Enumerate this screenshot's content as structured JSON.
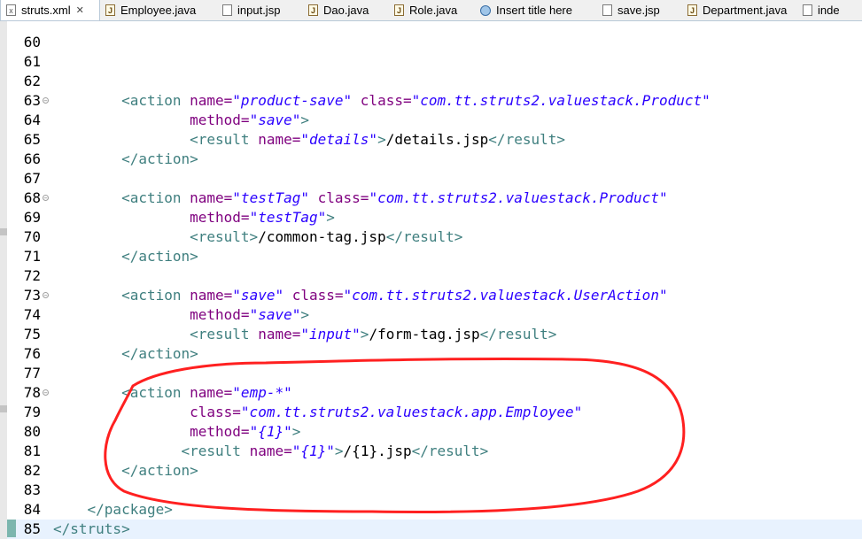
{
  "tabs": [
    {
      "label": "struts.xml",
      "icon": "xml-file-icon",
      "active": true
    },
    {
      "label": "Employee.java",
      "icon": "java-file-icon"
    },
    {
      "label": "input.jsp",
      "icon": "jsp-file-icon"
    },
    {
      "label": "Dao.java",
      "icon": "java-file-icon"
    },
    {
      "label": "Role.java",
      "icon": "java-file-icon"
    },
    {
      "label": "Insert title here",
      "icon": "web-browser-icon"
    },
    {
      "label": "save.jsp",
      "icon": "jsp-file-icon"
    },
    {
      "label": "Department.java",
      "icon": "java-file-icon"
    },
    {
      "label": "inde",
      "icon": "jsp-file-icon"
    }
  ],
  "close_glyph": "✕",
  "lines": [
    {
      "n": "60",
      "tokens": []
    },
    {
      "n": "61",
      "tokens": []
    },
    {
      "n": "62",
      "tokens": []
    },
    {
      "n": "63",
      "fold": true,
      "tokens": [
        {
          "t": "txt",
          "v": "        "
        },
        {
          "t": "tag",
          "v": "<action "
        },
        {
          "t": "attr",
          "v": "name="
        },
        {
          "t": "val",
          "v": "\"product-save\""
        },
        {
          "t": "txt",
          "v": " "
        },
        {
          "t": "attr",
          "v": "class="
        },
        {
          "t": "val",
          "v": "\"com.tt.struts2.valuestack.Product\""
        }
      ]
    },
    {
      "n": "64",
      "tokens": [
        {
          "t": "txt",
          "v": "                "
        },
        {
          "t": "attr",
          "v": "method="
        },
        {
          "t": "val",
          "v": "\"save\""
        },
        {
          "t": "tag",
          "v": ">"
        }
      ]
    },
    {
      "n": "65",
      "tokens": [
        {
          "t": "txt",
          "v": "                "
        },
        {
          "t": "tag",
          "v": "<result "
        },
        {
          "t": "attr",
          "v": "name="
        },
        {
          "t": "val",
          "v": "\"details\""
        },
        {
          "t": "tag",
          "v": ">"
        },
        {
          "t": "txt",
          "v": "/details.jsp"
        },
        {
          "t": "tag",
          "v": "</result>"
        }
      ]
    },
    {
      "n": "66",
      "tokens": [
        {
          "t": "txt",
          "v": "        "
        },
        {
          "t": "tag",
          "v": "</action>"
        }
      ]
    },
    {
      "n": "67",
      "tokens": []
    },
    {
      "n": "68",
      "fold": true,
      "tokens": [
        {
          "t": "txt",
          "v": "        "
        },
        {
          "t": "tag",
          "v": "<action "
        },
        {
          "t": "attr",
          "v": "name="
        },
        {
          "t": "val",
          "v": "\"testTag\""
        },
        {
          "t": "txt",
          "v": " "
        },
        {
          "t": "attr",
          "v": "class="
        },
        {
          "t": "val",
          "v": "\"com.tt.struts2.valuestack.Product\""
        }
      ]
    },
    {
      "n": "69",
      "tokens": [
        {
          "t": "txt",
          "v": "                "
        },
        {
          "t": "attr",
          "v": "method="
        },
        {
          "t": "val",
          "v": "\"testTag\""
        },
        {
          "t": "tag",
          "v": ">"
        }
      ]
    },
    {
      "n": "70",
      "tokens": [
        {
          "t": "txt",
          "v": "                "
        },
        {
          "t": "tag",
          "v": "<result>"
        },
        {
          "t": "txt",
          "v": "/common-tag.jsp"
        },
        {
          "t": "tag",
          "v": "</result>"
        }
      ]
    },
    {
      "n": "71",
      "tokens": [
        {
          "t": "txt",
          "v": "        "
        },
        {
          "t": "tag",
          "v": "</action>"
        }
      ]
    },
    {
      "n": "72",
      "tokens": []
    },
    {
      "n": "73",
      "fold": true,
      "tokens": [
        {
          "t": "txt",
          "v": "        "
        },
        {
          "t": "tag",
          "v": "<action "
        },
        {
          "t": "attr",
          "v": "name="
        },
        {
          "t": "val",
          "v": "\"save\""
        },
        {
          "t": "txt",
          "v": " "
        },
        {
          "t": "attr",
          "v": "class="
        },
        {
          "t": "val",
          "v": "\"com.tt.struts2.valuestack.UserAction\""
        }
      ]
    },
    {
      "n": "74",
      "tokens": [
        {
          "t": "txt",
          "v": "                "
        },
        {
          "t": "attr",
          "v": "method="
        },
        {
          "t": "val",
          "v": "\"save\""
        },
        {
          "t": "tag",
          "v": ">"
        }
      ]
    },
    {
      "n": "75",
      "tokens": [
        {
          "t": "txt",
          "v": "                "
        },
        {
          "t": "tag",
          "v": "<result "
        },
        {
          "t": "attr",
          "v": "name="
        },
        {
          "t": "val",
          "v": "\"input\""
        },
        {
          "t": "tag",
          "v": ">"
        },
        {
          "t": "txt",
          "v": "/form-tag.jsp"
        },
        {
          "t": "tag",
          "v": "</result>"
        }
      ]
    },
    {
      "n": "76",
      "tokens": [
        {
          "t": "txt",
          "v": "        "
        },
        {
          "t": "tag",
          "v": "</action>"
        }
      ]
    },
    {
      "n": "77",
      "tokens": []
    },
    {
      "n": "78",
      "fold": true,
      "tokens": [
        {
          "t": "txt",
          "v": "        "
        },
        {
          "t": "tag",
          "v": "<action "
        },
        {
          "t": "attr",
          "v": "name="
        },
        {
          "t": "val",
          "v": "\"emp-*\""
        }
      ]
    },
    {
      "n": "79",
      "tokens": [
        {
          "t": "txt",
          "v": "                "
        },
        {
          "t": "attr",
          "v": "class="
        },
        {
          "t": "val",
          "v": "\"com.tt.struts2.valuestack.app.Employee\""
        }
      ]
    },
    {
      "n": "80",
      "tokens": [
        {
          "t": "txt",
          "v": "                "
        },
        {
          "t": "attr",
          "v": "method="
        },
        {
          "t": "val",
          "v": "\"{1}\""
        },
        {
          "t": "tag",
          "v": ">"
        }
      ]
    },
    {
      "n": "81",
      "tokens": [
        {
          "t": "txt",
          "v": "               "
        },
        {
          "t": "tag",
          "v": "<result "
        },
        {
          "t": "attr",
          "v": "name="
        },
        {
          "t": "val",
          "v": "\"{1}\""
        },
        {
          "t": "tag",
          "v": ">"
        },
        {
          "t": "txt",
          "v": "/{1}.jsp"
        },
        {
          "t": "tag",
          "v": "</result>"
        }
      ]
    },
    {
      "n": "82",
      "tokens": [
        {
          "t": "txt",
          "v": "        "
        },
        {
          "t": "tag",
          "v": "</action>"
        }
      ]
    },
    {
      "n": "83",
      "tokens": []
    },
    {
      "n": "84",
      "tokens": [
        {
          "t": "txt",
          "v": "    "
        },
        {
          "t": "tag",
          "v": "</package>"
        }
      ]
    },
    {
      "n": "85",
      "current": true,
      "tokens": [
        {
          "t": "tag",
          "v": "</struts>"
        }
      ]
    }
  ],
  "colors": {
    "annotation": "#ff2020",
    "tag": "#3f7f7f",
    "attr": "#7f007f",
    "value": "#2a00ff"
  }
}
